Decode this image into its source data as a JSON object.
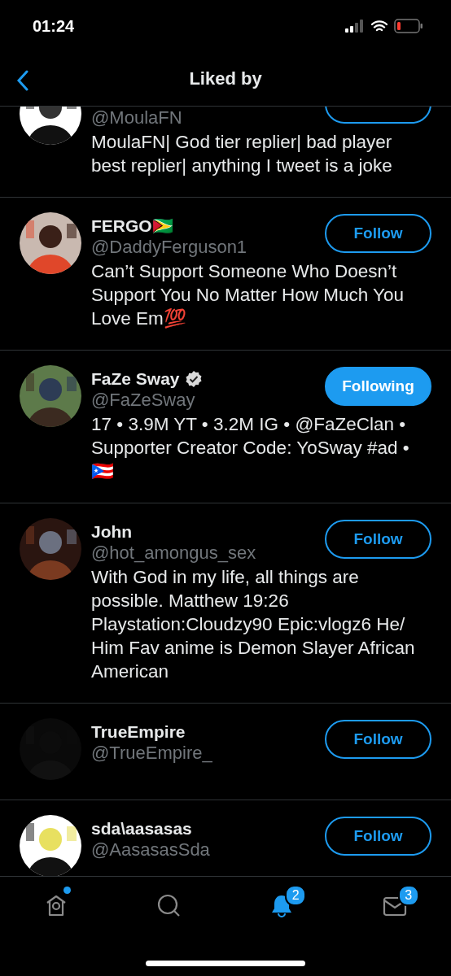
{
  "status_bar": {
    "time": "01:24",
    "battery_low": true
  },
  "header": {
    "title": "Liked by"
  },
  "users": [
    {
      "handle": "@MoulaFN",
      "bio": "MoulaFN| God tier replier| bad player best replier| anything I tweet is a joke",
      "following": false,
      "clipped": true
    },
    {
      "name": "FERGO🇬🇾",
      "handle": "@DaddyFerguson1",
      "bio": "Can’t Support Someone Who Doesn’t Support You No Matter How Much You Love Em💯",
      "following": false,
      "button": "Follow"
    },
    {
      "name": "FaZe Sway",
      "verified": true,
      "handle": "@FaZeSway",
      "bio": "17 • 3.9M YT • 3.2M IG • @FaZeClan • Supporter Creator Code: YoSway #ad •\n🇵🇷",
      "following": true,
      "button": "Following"
    },
    {
      "name": "John",
      "handle": "@hot_amongus_sex",
      "bio": "With God in my life, all things are possible. Matthew 19:26 Playstation:Cloudzy90 Epic:vlogz6 He/ Him Fav anime is Demon Slayer African American",
      "following": false,
      "button": "Follow"
    },
    {
      "name": "TrueEmpire",
      "handle": "@TrueEmpire_",
      "following": false,
      "button": "Follow"
    },
    {
      "name": "sda\\aasasas",
      "handle": "@AasasasSda",
      "following": false,
      "button": "Follow"
    }
  ],
  "tab_bar": [
    {
      "kind": "home",
      "selected": false,
      "dot": true
    },
    {
      "kind": "search",
      "selected": false
    },
    {
      "kind": "notifications",
      "selected": true,
      "badge": "2"
    },
    {
      "kind": "messages",
      "selected": false,
      "badge": "3"
    }
  ]
}
